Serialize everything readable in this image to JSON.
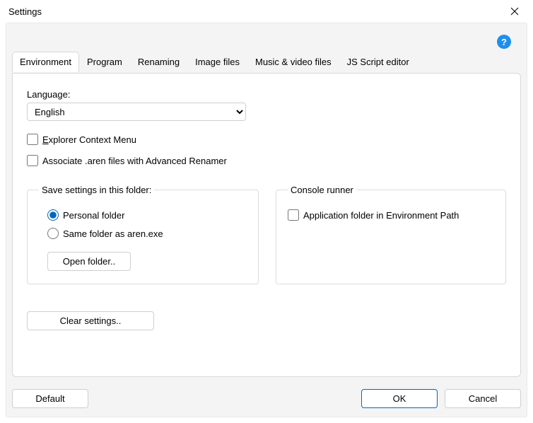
{
  "window": {
    "title": "Settings"
  },
  "tabs": {
    "environment": "Environment",
    "program": "Program",
    "renaming": "Renaming",
    "image_files": "Image files",
    "music_video": "Music & video files",
    "js_editor": "JS Script editor"
  },
  "environment": {
    "language_label": "Language:",
    "language_value": "English",
    "explorer_context_menu_pre": "",
    "explorer_context_menu_key": "E",
    "explorer_context_menu_post": "xplorer Context Menu",
    "associate_aren": "Associate .aren files with Advanced Renamer",
    "save_group": "Save settings in this folder:",
    "radio_personal": "Personal folder",
    "radio_same": "Same folder as aren.exe",
    "open_folder": "Open folder..",
    "console_group": "Console runner",
    "app_folder_env": "Application folder in Environment Path",
    "clear_settings": "Clear settings.."
  },
  "footer": {
    "default": "Default",
    "ok": "OK",
    "cancel": "Cancel"
  },
  "help_glyph": "?"
}
